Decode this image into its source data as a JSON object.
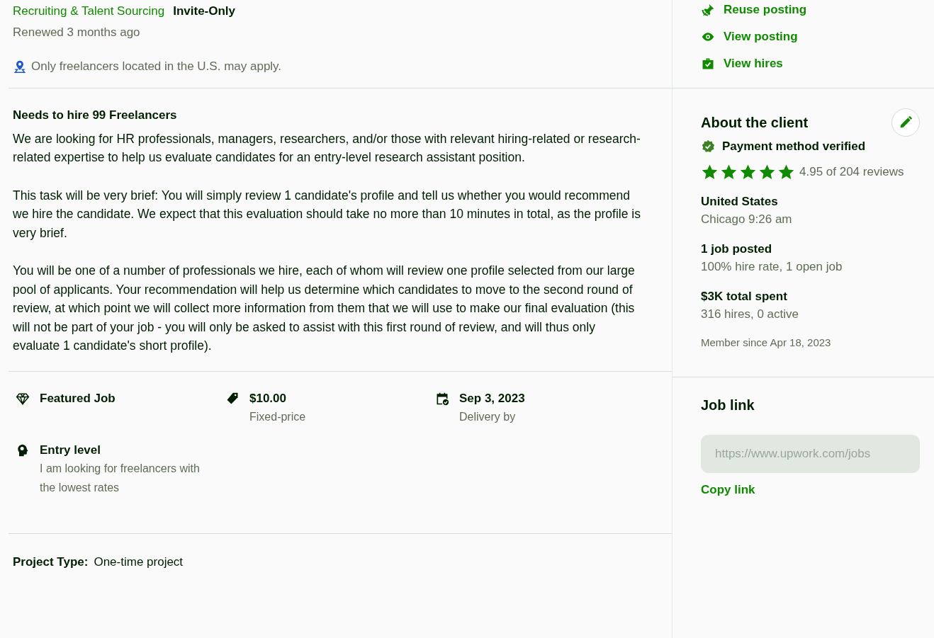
{
  "header": {
    "category": "Recruiting & Talent Sourcing",
    "badge": "Invite-Only",
    "renewed": "Renewed 3 months ago",
    "location_note": "Only freelancers located in the U.S. may apply."
  },
  "description": {
    "title": "Needs to hire 99 Freelancers",
    "paragraphs": [
      "We are looking for HR professionals, managers, researchers, and/or those with relevant hiring-related or research-related expertise to help us evaluate candidates for an entry-level research assistant position.",
      "This task will be very brief: You will simply review 1 candidate's profile and tell us whether you would recommend we hire the candidate. We expect that this evaluation should take no more than 10 minutes in total, as the profile is very brief.",
      "You will be one of a number of professionals we hire, each of whom will review one profile selected from our large pool of applicants. Your recommendation will help us determine which candidates to move to the second round of review, at which point we will collect more information from them that we will use to make our final evaluation (this will not be part of your job - you will only be asked to assist with this first round of review, and will thus only evaluate 1 candidate's short profile)."
    ]
  },
  "features": [
    {
      "kind": "featured",
      "title": "Featured Job"
    },
    {
      "kind": "price",
      "title": "$10.00",
      "subtitle": "Fixed-price"
    },
    {
      "kind": "date",
      "title": "Sep 3, 2023",
      "subtitle": "Delivery by"
    },
    {
      "kind": "level",
      "title": "Entry level",
      "subtitle": "I am looking for freelancers with the lowest rates"
    }
  ],
  "project_type": {
    "label": "Project Type:",
    "value": "One-time project"
  },
  "actions": [
    {
      "kind": "reuse",
      "label": "Reuse posting"
    },
    {
      "kind": "view",
      "label": "View posting"
    },
    {
      "kind": "hires",
      "label": "View hires"
    }
  ],
  "client": {
    "title": "About the client",
    "payment": "Payment method verified",
    "stars": 5,
    "rating": "4.95 of 204 reviews",
    "facts": [
      {
        "title": "United States",
        "detail": "Chicago 9:26 am"
      },
      {
        "title": "1 job posted",
        "detail": "100% hire rate, 1 open job"
      },
      {
        "title": "$3K total spent",
        "detail": "316 hires, 0 active"
      }
    ],
    "member_since": "Member since Apr 18, 2023"
  },
  "job_link": {
    "title": "Job link",
    "value": "https://www.upwork.com/jobs",
    "copy": "Copy link"
  }
}
